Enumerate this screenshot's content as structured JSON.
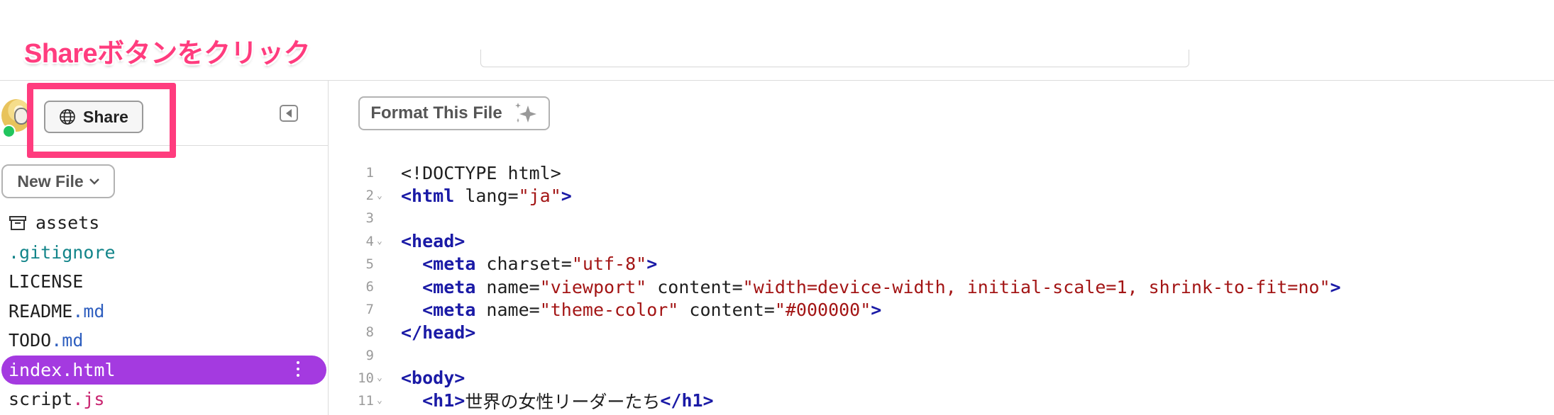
{
  "annotation": {
    "title": "Shareボタンをクリック",
    "highlight_color": "#ff3c7e"
  },
  "sidebar": {
    "share_label": "Share",
    "new_file_label": "New File",
    "files": [
      {
        "name": "assets",
        "ext": "",
        "icon": "archive-icon"
      },
      {
        "name": ".gitignore",
        "ext": "",
        "icon": ""
      },
      {
        "name": "LICENSE",
        "ext": "",
        "icon": ""
      },
      {
        "name": "README",
        "ext": ".md",
        "icon": ""
      },
      {
        "name": "TODO",
        "ext": ".md",
        "icon": ""
      },
      {
        "name": "index.html",
        "ext": "",
        "icon": "",
        "selected": true
      },
      {
        "name": "script",
        "ext": ".js",
        "icon": ""
      }
    ],
    "selected_color": "#a43ae0"
  },
  "editor": {
    "format_label": "Format This File",
    "lines": [
      {
        "n": "1",
        "fold": false,
        "text": "<!DOCTYPE html>"
      },
      {
        "n": "2",
        "fold": true,
        "text": "<html lang=\"ja\">"
      },
      {
        "n": "3",
        "fold": false,
        "text": ""
      },
      {
        "n": "4",
        "fold": true,
        "text": "<head>"
      },
      {
        "n": "5",
        "fold": false,
        "text": "  <meta charset=\"utf-8\">"
      },
      {
        "n": "6",
        "fold": false,
        "text": "  <meta name=\"viewport\" content=\"width=device-width, initial-scale=1, shrink-to-fit=no\">"
      },
      {
        "n": "7",
        "fold": false,
        "text": "  <meta name=\"theme-color\" content=\"#000000\">"
      },
      {
        "n": "8",
        "fold": false,
        "text": "</head>"
      },
      {
        "n": "9",
        "fold": false,
        "text": ""
      },
      {
        "n": "10",
        "fold": true,
        "text": "<body>"
      },
      {
        "n": "11",
        "fold": true,
        "text": "  <h1>世界の女性リーダーたち</h1>"
      }
    ]
  }
}
